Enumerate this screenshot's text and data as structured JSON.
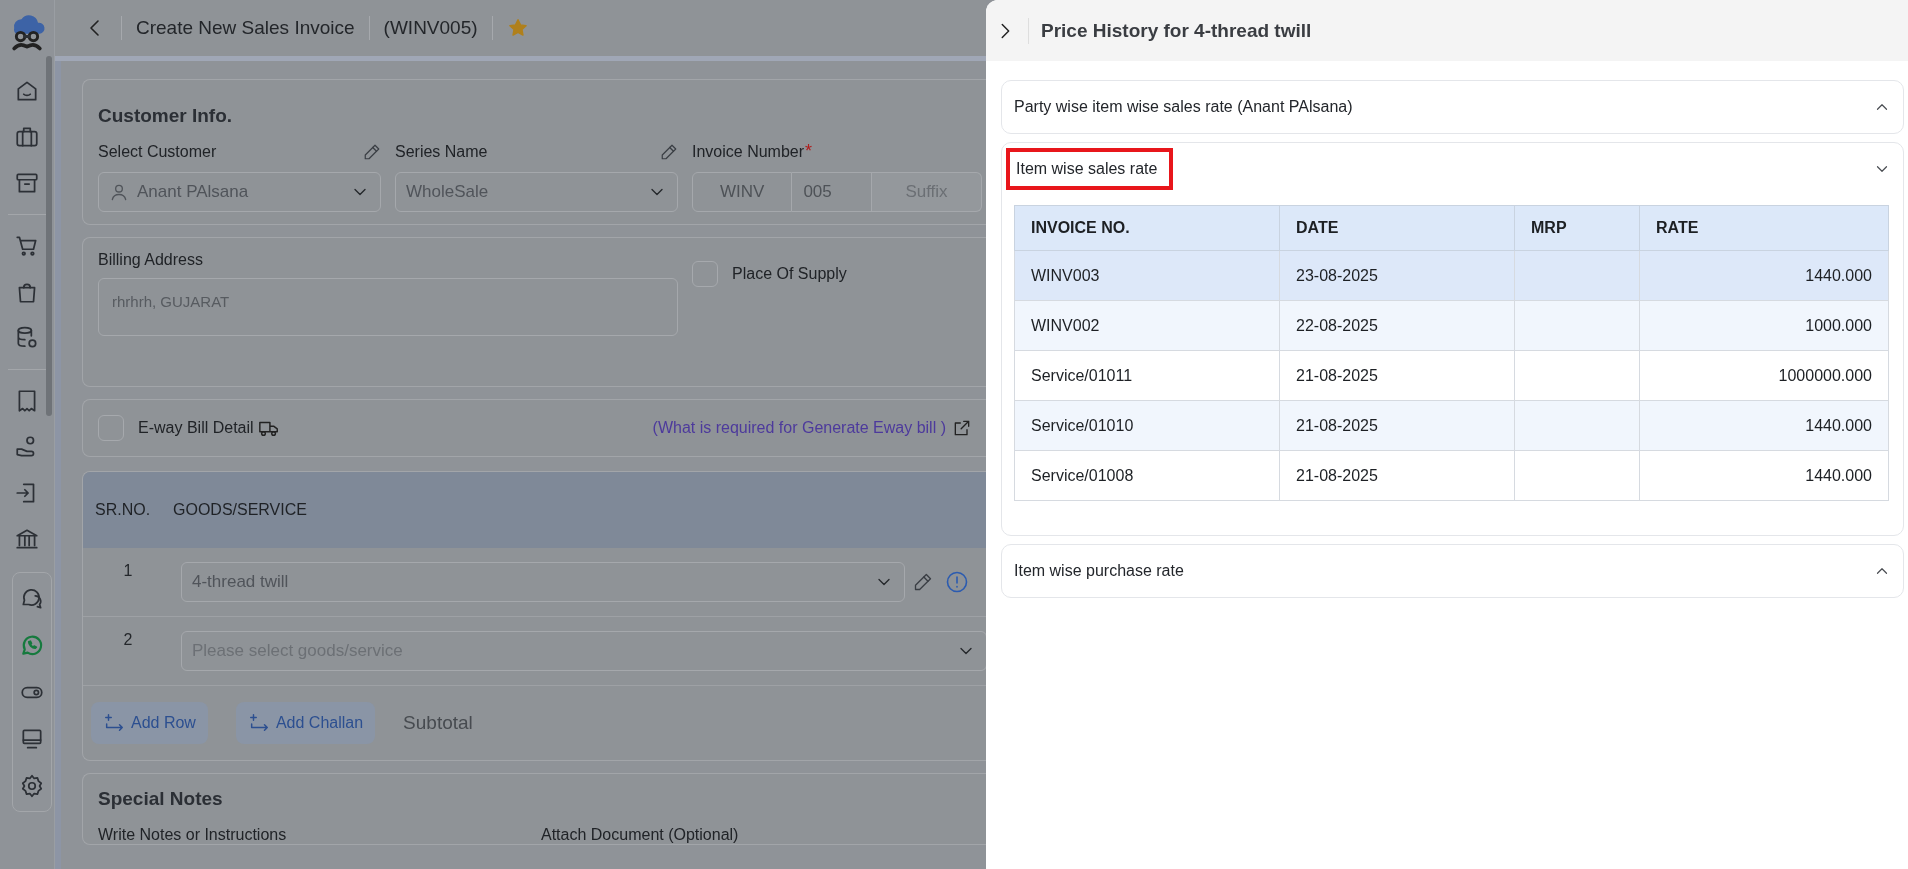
{
  "header": {
    "title": "Create New Sales Invoice",
    "number": "(WINV005)",
    "starred": true
  },
  "customer_info": {
    "title": "Customer Info.",
    "customer": {
      "label": "Select Customer",
      "value": "Anant PAlsana"
    },
    "series": {
      "label": "Series Name",
      "value": "WholeSale"
    },
    "invoice": {
      "label": "Invoice Number",
      "required_mark": "*",
      "prefix": "WINV",
      "number": "005",
      "suffix_placeholder": "Suffix"
    }
  },
  "billing": {
    "label": "Billing Address",
    "value": "rhrhrh, GUJARAT",
    "place_of_supply": {
      "label": "Place Of Supply",
      "checked": false
    }
  },
  "eway": {
    "label": "E-way Bill Detail",
    "checked": false,
    "link": "(What is required for Generate Eway bill )"
  },
  "items": {
    "columns": [
      "SR.NO.",
      "GOODS/SERVICE"
    ],
    "rows": [
      {
        "sr": "1",
        "value": "4-thread twill"
      },
      {
        "sr": "2",
        "placeholder": "Please select goods/service"
      }
    ],
    "actions": [
      "Add Row",
      "Add Challan"
    ],
    "subtotal": "Subtotal"
  },
  "notes": {
    "title": "Special Notes",
    "labels": [
      "Write Notes or Instructions",
      "Attach Document (Optional)"
    ]
  },
  "drawer": {
    "title": "Price History for 4-thread twill",
    "sections": [
      {
        "title": "Party wise item wise sales rate (Anant PAlsana)",
        "expanded": false,
        "highlighted": false
      },
      {
        "title": "Item wise sales rate",
        "expanded": true,
        "highlighted": true,
        "table": {
          "columns": [
            "INVOICE NO.",
            "DATE",
            "MRP",
            "RATE"
          ],
          "rows": [
            {
              "invoice": "WINV003",
              "date": "23-08-2025",
              "rate": "1440.000",
              "selected": true
            },
            {
              "invoice": "WINV002",
              "date": "22-08-2025",
              "rate": "1000.000",
              "selected": false
            },
            {
              "invoice": "Service/01011",
              "date": "21-08-2025",
              "rate": "1000000.000",
              "selected": false
            },
            {
              "invoice": "Service/01010",
              "date": "21-08-2025",
              "rate": "1440.000",
              "selected": false
            },
            {
              "invoice": "Service/01008",
              "date": "21-08-2025",
              "rate": "1440.000",
              "selected": false
            }
          ]
        }
      },
      {
        "title": "Item wise purchase rate",
        "expanded": false,
        "highlighted": false
      }
    ]
  }
}
